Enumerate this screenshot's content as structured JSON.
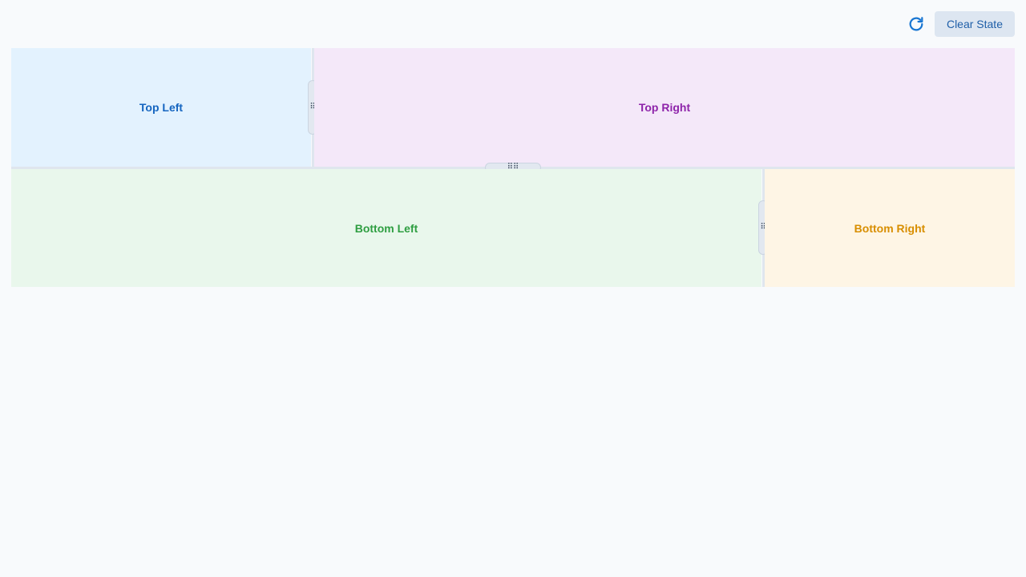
{
  "toolbar": {
    "refresh_icon": "refresh-icon",
    "clear_label": "Clear State"
  },
  "panes": {
    "top_left": "Top Left",
    "top_right": "Top Right",
    "bottom_left": "Bottom Left",
    "bottom_right": "Bottom Right"
  },
  "handles": {
    "vertical_glyph": "⠿",
    "horizontal_glyph": "⠿⠿"
  },
  "colors": {
    "top_left_bg": "#e3f2fe",
    "top_right_bg": "#f4e8f9",
    "bottom_left_bg": "#e9f7ec",
    "bottom_right_bg": "#fef5e5",
    "accent": "#1976d2"
  }
}
